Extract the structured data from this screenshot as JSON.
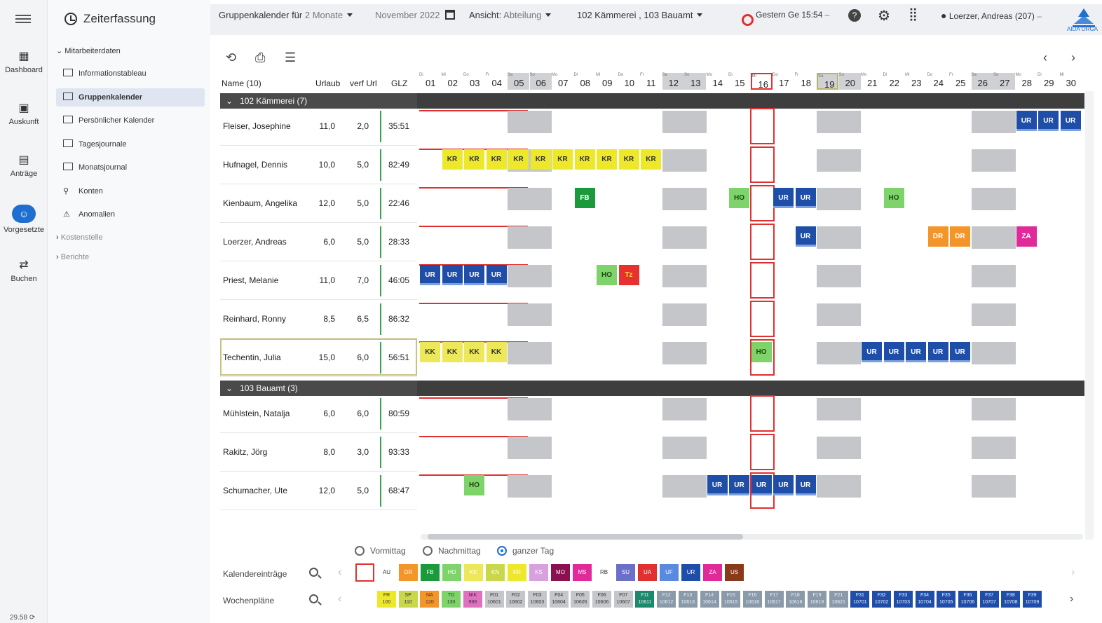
{
  "rail": {
    "items": [
      {
        "label": "Dashboard",
        "icon": "dashboard-icon"
      },
      {
        "label": "Auskunft",
        "icon": "info-icon"
      },
      {
        "label": "Anträge",
        "icon": "document-icon"
      },
      {
        "label": "Vorgesetzte",
        "icon": "team-icon"
      },
      {
        "label": "Buchen",
        "icon": "swap-icon"
      }
    ],
    "footer": "29.58"
  },
  "nav": {
    "title": "Zeiterfassung",
    "group_mitarbeiter": "Mitarbeiterdaten",
    "items": [
      {
        "label": "Informationstableau"
      },
      {
        "label": "Gruppenkalender"
      },
      {
        "label": "Persönlicher Kalender"
      },
      {
        "label": "Tagesjournale"
      },
      {
        "label": "Monatsjournal"
      },
      {
        "label": "Konten"
      },
      {
        "label": "Anomalien"
      }
    ],
    "group_kostenstelle": "Kostenstelle",
    "group_berichte": "Berichte"
  },
  "topbar": {
    "calendar_label": "Gruppenkalender für",
    "period": "2 Monate",
    "month": "November 2022",
    "view_label": "Ansicht:",
    "view_value": "Abteilung",
    "departments": "102 Kämmerei , 103 Bauamt",
    "gestern": "Gestern Ge 15:54",
    "user": "Loerzer, Andreas (207)",
    "logo_text": "AIDA ORGA"
  },
  "grid": {
    "headers": {
      "name": "Name (10)",
      "urlaub": "Urlaub",
      "verf": "verf Url",
      "glz": "GLZ"
    },
    "days": [
      "01",
      "02",
      "03",
      "04",
      "05",
      "06",
      "07",
      "08",
      "09",
      "10",
      "11",
      "12",
      "13",
      "14",
      "15",
      "16",
      "17",
      "18",
      "19",
      "20",
      "21",
      "22",
      "23",
      "24",
      "25",
      "26",
      "27",
      "28",
      "29",
      "30"
    ],
    "weekdays": [
      "Di",
      "Mi",
      "Do",
      "Fr",
      "Sa",
      "So",
      "Mo",
      "Di",
      "Mi",
      "Do",
      "Fr",
      "Sa",
      "So",
      "Mo",
      "Di",
      "Mi",
      "Do",
      "Fr",
      "Sa",
      "So",
      "Mo",
      "Di",
      "Mi",
      "Do",
      "Fr",
      "Sa",
      "So",
      "Mo",
      "Di",
      "Mi"
    ],
    "groups": [
      {
        "label": "102 Kämmerei (7)"
      },
      {
        "label": "103 Bauamt (3)"
      }
    ],
    "employees": [
      {
        "name": "Fleiser, Josephine",
        "urlaub": "11,0",
        "verf": "2,0",
        "glz": "35:51"
      },
      {
        "name": "Hufnagel, Dennis",
        "urlaub": "10,0",
        "verf": "5,0",
        "glz": "82:49"
      },
      {
        "name": "Kienbaum, Angelika",
        "urlaub": "12,0",
        "verf": "5,0",
        "glz": "22:46"
      },
      {
        "name": "Loerzer, Andreas",
        "urlaub": "6,0",
        "verf": "5,0",
        "glz": "28:33"
      },
      {
        "name": "Priest, Melanie",
        "urlaub": "11,0",
        "verf": "7,0",
        "glz": "46:05"
      },
      {
        "name": "Reinhard, Ronny",
        "urlaub": "8,5",
        "verf": "6,5",
        "glz": "86:32"
      },
      {
        "name": "Techentin, Julia",
        "urlaub": "15,0",
        "verf": "6,0",
        "glz": "56:51"
      },
      {
        "name": "Mühlstein, Natalja",
        "urlaub": "6,0",
        "verf": "6,0",
        "glz": "80:59"
      },
      {
        "name": "Rakitz, Jörg",
        "urlaub": "8,0",
        "verf": "3,0",
        "glz": "93:33"
      },
      {
        "name": "Schumacher, Ute",
        "urlaub": "12,0",
        "verf": "5,0",
        "glz": "68:47"
      }
    ],
    "entries": [
      {
        "row": 0,
        "day": 28,
        "code": "UR"
      },
      {
        "row": 0,
        "day": 29,
        "code": "UR"
      },
      {
        "row": 0,
        "day": 30,
        "code": "UR"
      },
      {
        "row": 1,
        "day": 2,
        "code": "KR"
      },
      {
        "row": 1,
        "day": 3,
        "code": "KR"
      },
      {
        "row": 1,
        "day": 4,
        "code": "KR"
      },
      {
        "row": 1,
        "day": 5,
        "code": "KR"
      },
      {
        "row": 1,
        "day": 6,
        "code": "KR"
      },
      {
        "row": 1,
        "day": 7,
        "code": "KR"
      },
      {
        "row": 1,
        "day": 8,
        "code": "KR"
      },
      {
        "row": 1,
        "day": 9,
        "code": "KR"
      },
      {
        "row": 1,
        "day": 10,
        "code": "KR"
      },
      {
        "row": 1,
        "day": 11,
        "code": "KR"
      },
      {
        "row": 2,
        "day": 8,
        "code": "FB"
      },
      {
        "row": 2,
        "day": 15,
        "code": "HO"
      },
      {
        "row": 2,
        "day": 17,
        "code": "UR"
      },
      {
        "row": 2,
        "day": 18,
        "code": "UR"
      },
      {
        "row": 2,
        "day": 22,
        "code": "HO"
      },
      {
        "row": 3,
        "day": 18,
        "code": "UR"
      },
      {
        "row": 3,
        "day": 24,
        "code": "DR"
      },
      {
        "row": 3,
        "day": 25,
        "code": "DR"
      },
      {
        "row": 3,
        "day": 28,
        "code": "ZA"
      },
      {
        "row": 4,
        "day": 1,
        "code": "UR"
      },
      {
        "row": 4,
        "day": 2,
        "code": "UR"
      },
      {
        "row": 4,
        "day": 3,
        "code": "UR"
      },
      {
        "row": 4,
        "day": 4,
        "code": "UR"
      },
      {
        "row": 4,
        "day": 9,
        "code": "HO"
      },
      {
        "row": 4,
        "day": 10,
        "code": "TZ"
      },
      {
        "row": 6,
        "day": 1,
        "code": "KK"
      },
      {
        "row": 6,
        "day": 2,
        "code": "KK"
      },
      {
        "row": 6,
        "day": 3,
        "code": "KK"
      },
      {
        "row": 6,
        "day": 4,
        "code": "KK"
      },
      {
        "row": 6,
        "day": 16,
        "code": "HO"
      },
      {
        "row": 6,
        "day": 21,
        "code": "UR"
      },
      {
        "row": 6,
        "day": 22,
        "code": "UR"
      },
      {
        "row": 6,
        "day": 23,
        "code": "UR"
      },
      {
        "row": 6,
        "day": 24,
        "code": "UR"
      },
      {
        "row": 6,
        "day": 25,
        "code": "UR"
      },
      {
        "row": 9,
        "day": 3,
        "code": "HO"
      },
      {
        "row": 9,
        "day": 14,
        "code": "UR"
      },
      {
        "row": 9,
        "day": 15,
        "code": "UR"
      },
      {
        "row": 9,
        "day": 16,
        "code": "UR"
      },
      {
        "row": 9,
        "day": 17,
        "code": "UR"
      },
      {
        "row": 9,
        "day": 18,
        "code": "UR"
      }
    ],
    "entry_labels": {
      "UR": "UR",
      "KR": "KR",
      "KK": "KK",
      "HO": "HO",
      "FB": "FB",
      "DR": "DR",
      "ZA": "ZA",
      "TZ": "Tz"
    }
  },
  "legend": {
    "radio_am": "Vormittag",
    "radio_pm": "Nachmittag",
    "radio_full": "ganzer Tag",
    "kalender_label": "Kalendereinträge",
    "wochen_label": "Wochenpläne",
    "kalender_codes": [
      {
        "code": "AU",
        "color": "#ffffff"
      },
      {
        "code": "DR",
        "color": "#f39528"
      },
      {
        "code": "FB",
        "color": "#1a9a3a"
      },
      {
        "code": "HO",
        "color": "#7ed36a"
      },
      {
        "code": "KK",
        "color": "#ede85a"
      },
      {
        "code": "KN",
        "color": "#c9d84a"
      },
      {
        "code": "KR",
        "color": "#ede82a"
      },
      {
        "code": "KS",
        "color": "#d9a0e0"
      },
      {
        "code": "MO",
        "color": "#8a1050"
      },
      {
        "code": "MS",
        "color": "#e02a9a"
      },
      {
        "code": "RB",
        "color": "#ffffff"
      },
      {
        "code": "SU",
        "color": "#6a70c8"
      },
      {
        "code": "UA",
        "color": "#e03030"
      },
      {
        "code": "UF",
        "color": "#5a8ae0"
      },
      {
        "code": "UR",
        "color": "#1f4ea8"
      },
      {
        "code": "ZA",
        "color": "#e02a9a"
      },
      {
        "code": "US",
        "color": "#8a3a1a"
      }
    ],
    "wochen_codes": [
      {
        "code": "FR",
        "sub": "100",
        "color": "#ede82a"
      },
      {
        "code": "SP",
        "sub": "110",
        "color": "#c9d84a"
      },
      {
        "code": "NA",
        "sub": "120",
        "color": "#f39528"
      },
      {
        "code": "TD",
        "sub": "130",
        "color": "#7ed36a"
      },
      {
        "code": "NIK",
        "sub": "999",
        "color": "#e070c0"
      },
      {
        "code": "F01",
        "sub": "10601",
        "color": "#c4c6c9"
      },
      {
        "code": "F02",
        "sub": "10602",
        "color": "#c4c6c9"
      },
      {
        "code": "F03",
        "sub": "10603",
        "color": "#c4c6c9"
      },
      {
        "code": "F04",
        "sub": "10604",
        "color": "#c4c6c9"
      },
      {
        "code": "F05",
        "sub": "10605",
        "color": "#c4c6c9"
      },
      {
        "code": "F06",
        "sub": "10606",
        "color": "#c4c6c9"
      },
      {
        "code": "F07",
        "sub": "10607",
        "color": "#c4c6c9"
      },
      {
        "code": "F11",
        "sub": "10611",
        "color": "#1a8a6a"
      },
      {
        "code": "F12",
        "sub": "10612",
        "color": "#8a9aa8"
      },
      {
        "code": "F13",
        "sub": "10613",
        "color": "#8a9aa8"
      },
      {
        "code": "F14",
        "sub": "10614",
        "color": "#8a9aa8"
      },
      {
        "code": "F15",
        "sub": "10615",
        "color": "#8a9aa8"
      },
      {
        "code": "F16",
        "sub": "10616",
        "color": "#8a9aa8"
      },
      {
        "code": "F17",
        "sub": "10617",
        "color": "#8a9aa8"
      },
      {
        "code": "F18",
        "sub": "10618",
        "color": "#8a9aa8"
      },
      {
        "code": "F19",
        "sub": "10619",
        "color": "#8a9aa8"
      },
      {
        "code": "F21",
        "sub": "10621",
        "color": "#8a9aa8"
      },
      {
        "code": "F31",
        "sub": "10701",
        "color": "#1f4ea8"
      },
      {
        "code": "F32",
        "sub": "10702",
        "color": "#1f4ea8"
      },
      {
        "code": "F33",
        "sub": "10703",
        "color": "#1f4ea8"
      },
      {
        "code": "F34",
        "sub": "10704",
        "color": "#1f4ea8"
      },
      {
        "code": "F35",
        "sub": "10705",
        "color": "#1f4ea8"
      },
      {
        "code": "F36",
        "sub": "10706",
        "color": "#1f4ea8"
      },
      {
        "code": "F37",
        "sub": "10707",
        "color": "#1f4ea8"
      },
      {
        "code": "F38",
        "sub": "10708",
        "color": "#1f4ea8"
      },
      {
        "code": "F39",
        "sub": "10709",
        "color": "#1f4ea8"
      }
    ]
  }
}
